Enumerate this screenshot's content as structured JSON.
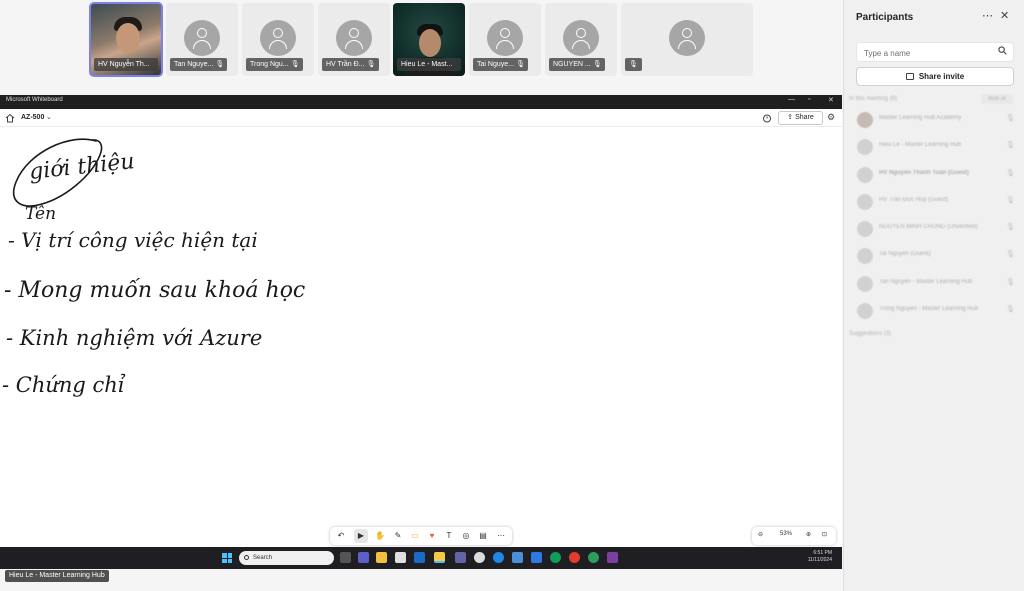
{
  "video_strip": {
    "tiles": [
      {
        "name": "HV Nguyễn Th..."
      },
      {
        "name": "Tan Nguye..."
      },
      {
        "name": "Trong Ngu..."
      },
      {
        "name": "HV Trần Đ..."
      },
      {
        "name": "Hieu Le - Mast..."
      },
      {
        "name": "Tai Nguye..."
      },
      {
        "name": "NGUYEN ..."
      },
      {
        "name": ""
      }
    ]
  },
  "participants": {
    "title": "Participants",
    "search_placeholder": "Type a name",
    "invite_label": "Share invite",
    "in_meeting_label": "In this meeting (8)",
    "mute_all_label": "Mute all",
    "list": [
      {
        "name": "Master Learning Hub Academy",
        "role": "Organizer"
      },
      {
        "name": "Hieu Le - Master Learning Hub"
      },
      {
        "name": "HV Nguyễn Thanh Tuấn (Guest)"
      },
      {
        "name": "HV Trần Đức Huy (Guest)"
      },
      {
        "name": "NGUYEN MINH CHUNG (Unverified)"
      },
      {
        "name": "Tai Nguyen (Guest)"
      },
      {
        "name": "Tan Nguyen - Master Learning Hub"
      },
      {
        "name": "Trong Nguyen - Master Learning Hub"
      }
    ],
    "suggestions_label": "Suggestions (3)"
  },
  "whiteboard": {
    "app_title": "Microsoft Whiteboard",
    "board_name": "AZ-500",
    "share_label": "Share",
    "zoom": "53%",
    "handwriting": [
      "giới thiệu",
      "Tên",
      "- Vị trí công việc hiện tại",
      "- Mong muốn sau khoá học",
      "- Kinh nghiệm với Azure",
      "- Chứng chỉ"
    ]
  },
  "taskbar": {
    "search_placeholder": "Search",
    "time": "6:51 PM",
    "date": "11/11/2024"
  },
  "presenter_caption": "Hieu Le - Master Learning Hub"
}
